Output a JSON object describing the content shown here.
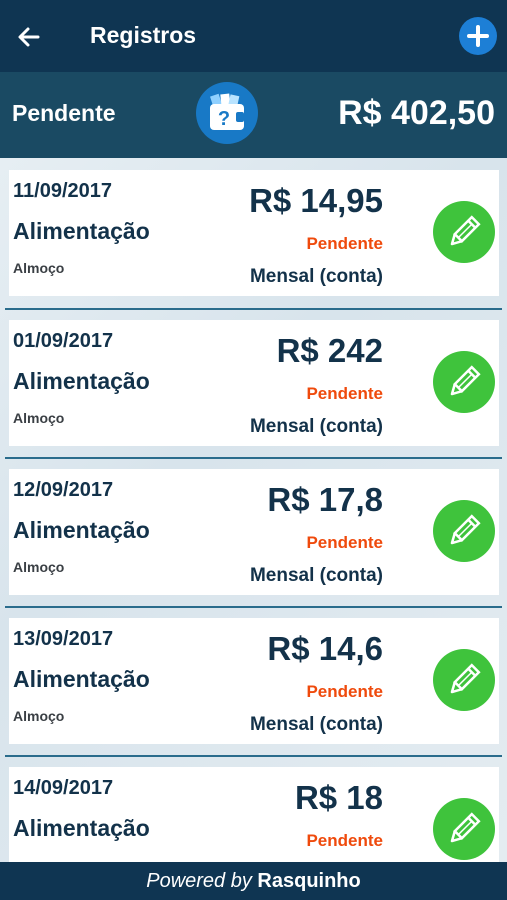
{
  "header": {
    "title": "Registros"
  },
  "summary": {
    "label": "Pendente",
    "total": "R$ 402,50"
  },
  "records": [
    {
      "date": "11/09/2017",
      "category": "Alimentação",
      "description": "Almoço",
      "amount": "R$ 14,95",
      "status": "Pendente",
      "period": "Mensal (conta)"
    },
    {
      "date": "01/09/2017",
      "category": "Alimentação",
      "description": "Almoço",
      "amount": "R$ 242",
      "status": "Pendente",
      "period": "Mensal (conta)"
    },
    {
      "date": "12/09/2017",
      "category": "Alimentação",
      "description": "Almoço",
      "amount": "R$ 17,8",
      "status": "Pendente",
      "period": "Mensal (conta)"
    },
    {
      "date": "13/09/2017",
      "category": "Alimentação",
      "description": "Almoço",
      "amount": "R$ 14,6",
      "status": "Pendente",
      "period": "Mensal (conta)"
    },
    {
      "date": "14/09/2017",
      "category": "Alimentação",
      "description": "",
      "amount": "R$ 18",
      "status": "Pendente",
      "period": ""
    }
  ],
  "footer": {
    "prefix": "Powered by ",
    "brand": "Rasquinho"
  },
  "colors": {
    "header_bg": "#0f3552",
    "summary_bg": "#1a4a63",
    "status": "#ef4a0c",
    "edit_button": "#3fc33c",
    "accent": "#1d7fd6"
  },
  "icons": {
    "back": "arrow-left-icon",
    "add": "plus-icon",
    "wallet": "wallet-question-icon",
    "edit": "pencil-icon"
  }
}
